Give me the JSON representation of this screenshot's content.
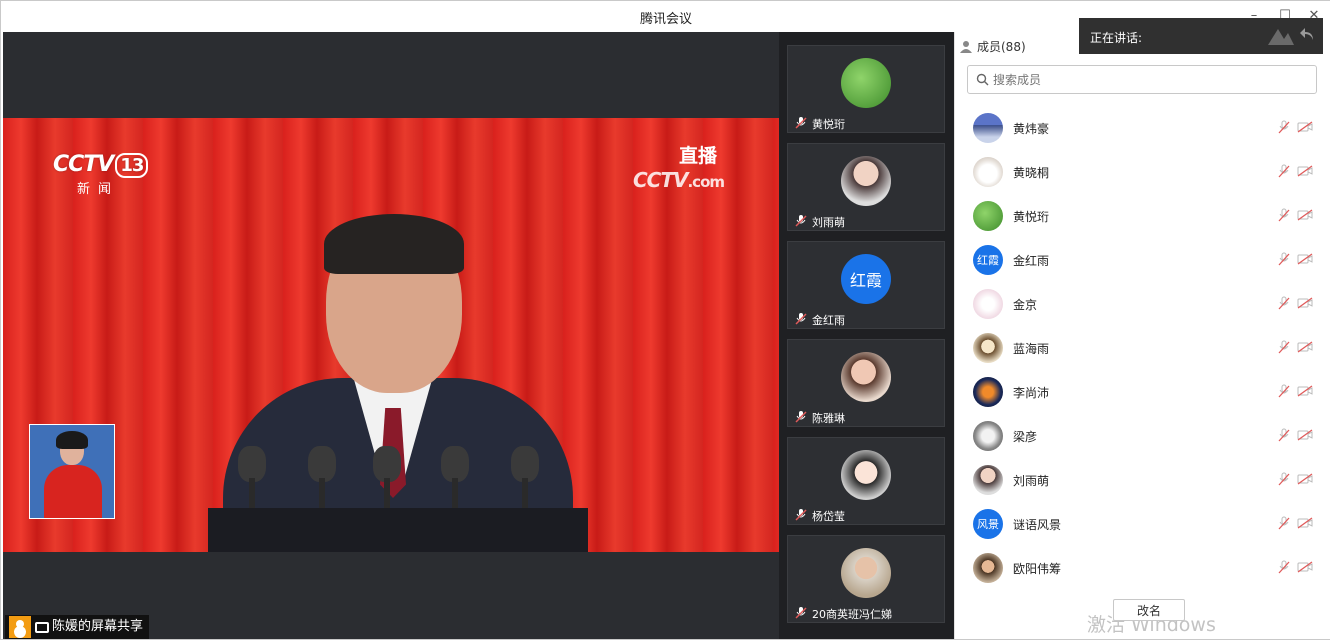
{
  "window": {
    "title": "腾讯会议"
  },
  "share": {
    "label": "陈媛的屏幕共享",
    "channel_logo": "CCTV",
    "channel_number": "13",
    "channel_sub": "新闻",
    "live_text": "直播",
    "live_logo": "CCTV",
    "live_logo_suffix": ".com"
  },
  "tiles": [
    {
      "name": "黄悦珩",
      "avatar": "green-leaf"
    },
    {
      "name": "刘雨萌",
      "avatar": "photo-girl"
    },
    {
      "name": "金红雨",
      "avatar_text": "红霞",
      "avatar_color": "#1a73e8"
    },
    {
      "name": "陈雅琳",
      "avatar": "photo-girl-2"
    },
    {
      "name": "杨岱莹",
      "avatar": "anime-girl"
    },
    {
      "name": "20商英班冯仁娣",
      "avatar": "photo-boy"
    }
  ],
  "members": {
    "title": "成员(88)",
    "search_placeholder": "搜索成员",
    "list": [
      {
        "name": "黄炜豪",
        "avatar": "landscape"
      },
      {
        "name": "黄晓桐",
        "avatar": "puppy"
      },
      {
        "name": "黄悦珩",
        "avatar": "green-leaf"
      },
      {
        "name": "金红雨",
        "avatar_text": "红霞"
      },
      {
        "name": "金京",
        "avatar": "floral"
      },
      {
        "name": "蓝海雨",
        "avatar": "cartoon"
      },
      {
        "name": "李尚沛",
        "avatar": "fire-logo"
      },
      {
        "name": "梁彦",
        "avatar": "cat"
      },
      {
        "name": "刘雨萌",
        "avatar": "photo-girl"
      },
      {
        "name": "谜语风景",
        "avatar_text": "风景"
      },
      {
        "name": "欧阳伟筹",
        "avatar": "photo-man"
      }
    ],
    "rename_label": "改名"
  },
  "speaking": {
    "label": "正在讲话:"
  },
  "watermark": "激活 Windows",
  "colors": {
    "accent": "#1a73e8",
    "share_badge": "#f39c12",
    "muted_icon": "#e05a5a"
  }
}
